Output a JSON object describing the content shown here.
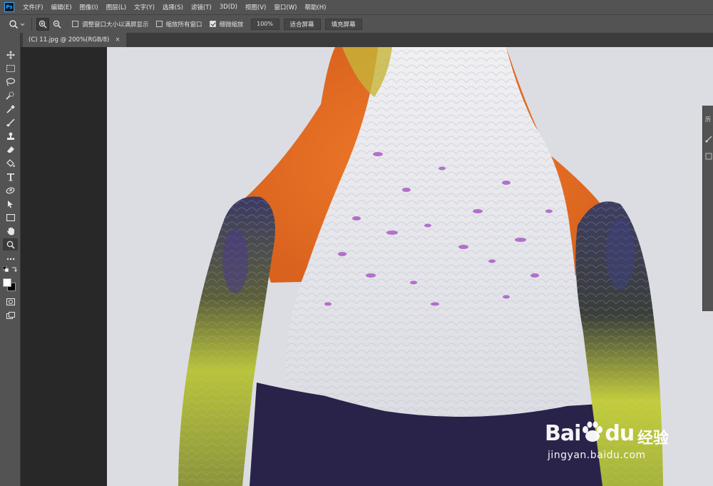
{
  "app": {
    "logo_text": "Ps"
  },
  "menu": [
    "文件(F)",
    "编辑(E)",
    "图像(I)",
    "图层(L)",
    "文字(Y)",
    "选择(S)",
    "滤镜(T)",
    "3D(D)",
    "视图(V)",
    "窗口(W)",
    "帮助(H)"
  ],
  "options": {
    "tool_icon": "zoom-icon",
    "zoom_in_icon": "zoom-in-icon",
    "zoom_out_icon": "zoom-out-icon",
    "resize_windows_label": "调整窗口大小以满屏显示",
    "resize_windows_checked": false,
    "zoom_all_windows_label": "缩放所有窗口",
    "zoom_all_windows_checked": false,
    "scrubby_zoom_label": "细微缩放",
    "scrubby_zoom_checked": true,
    "zoom_level": "100%",
    "fit_screen_label": "适合屏幕",
    "fill_screen_label": "填充屏幕"
  },
  "document": {
    "tab_title": "(C) 11.jpg @ 200%(RGB/8)",
    "close_glyph": "×",
    "image_description_colors": {
      "background": "#dcdde2",
      "orange": "#e8742a",
      "white": "#dedfe6",
      "purple": "#a04ac0",
      "navy": "#28224a",
      "green": "#b9c43a"
    }
  },
  "toolbar": {
    "tools": [
      "move-icon",
      "marquee-icon",
      "lasso-icon",
      "quick-select-icon",
      "eyedropper-icon",
      "brush-icon",
      "stamp-icon",
      "eraser-icon",
      "paint-bucket-icon",
      "type-icon",
      "pen-icon",
      "path-select-icon",
      "rectangle-icon",
      "hand-icon",
      "zoom-icon",
      "more-icon"
    ],
    "active_tool": "zoom-icon",
    "foreground_color": "#ffffff",
    "background_color": "#000000"
  },
  "right_panel": {
    "glyph_top": "历"
  },
  "watermark": {
    "logo": "Bai",
    "logo_suffix": "du",
    "cn": "经验",
    "url": "jingyan.baidu.com"
  }
}
